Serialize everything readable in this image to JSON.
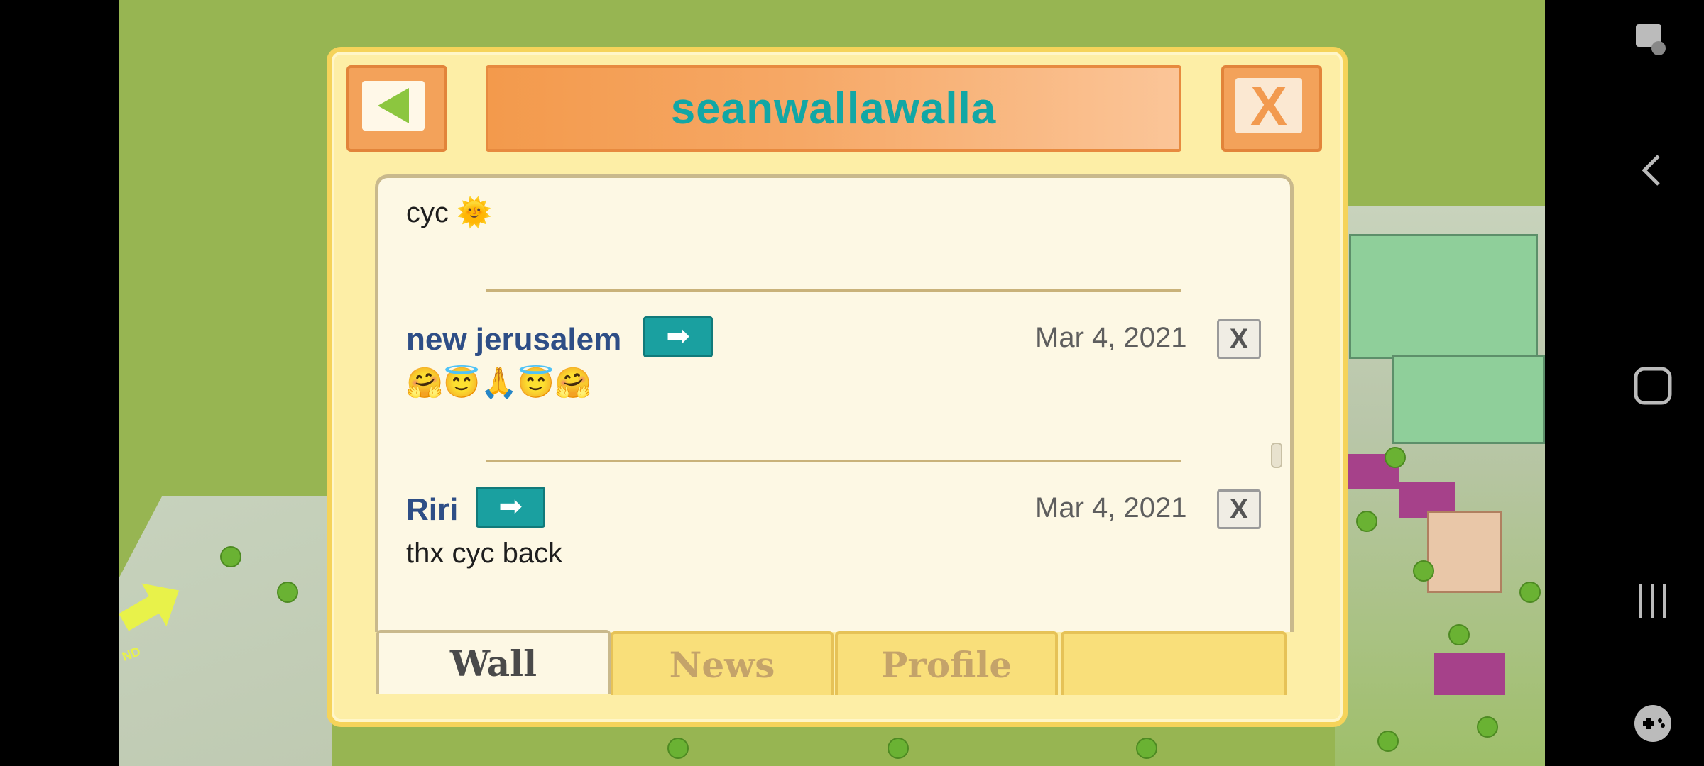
{
  "dialog": {
    "title": "seanwallawalla",
    "back_label": "back",
    "close_label": "X"
  },
  "posts": [
    {
      "author": "",
      "date": "",
      "text": "cyc 🌞"
    },
    {
      "author": "new jerusalem",
      "date": "Mar 4, 2021",
      "text": "🤗😇🙏😇🤗"
    },
    {
      "author": "Riri",
      "date": "Mar 4, 2021",
      "text": "thx cyc back"
    }
  ],
  "post_controls": {
    "goto_symbol": "➡",
    "delete_symbol": "X"
  },
  "tabs": [
    {
      "label": "Wall",
      "active": true
    },
    {
      "label": "News",
      "active": false
    },
    {
      "label": "Profile",
      "active": false
    },
    {
      "label": "",
      "active": false
    }
  ],
  "game_bg": {
    "arrow_label": "ND"
  },
  "colors": {
    "title": "#12a7a5",
    "author": "#2e4e86",
    "panel": "#fdf8e4",
    "dialog": "#fdeea6"
  },
  "system_nav": [
    "screen-touch-icon",
    "back-chevron-icon",
    "home-square-icon",
    "recents-icon",
    "game-controller-icon"
  ]
}
